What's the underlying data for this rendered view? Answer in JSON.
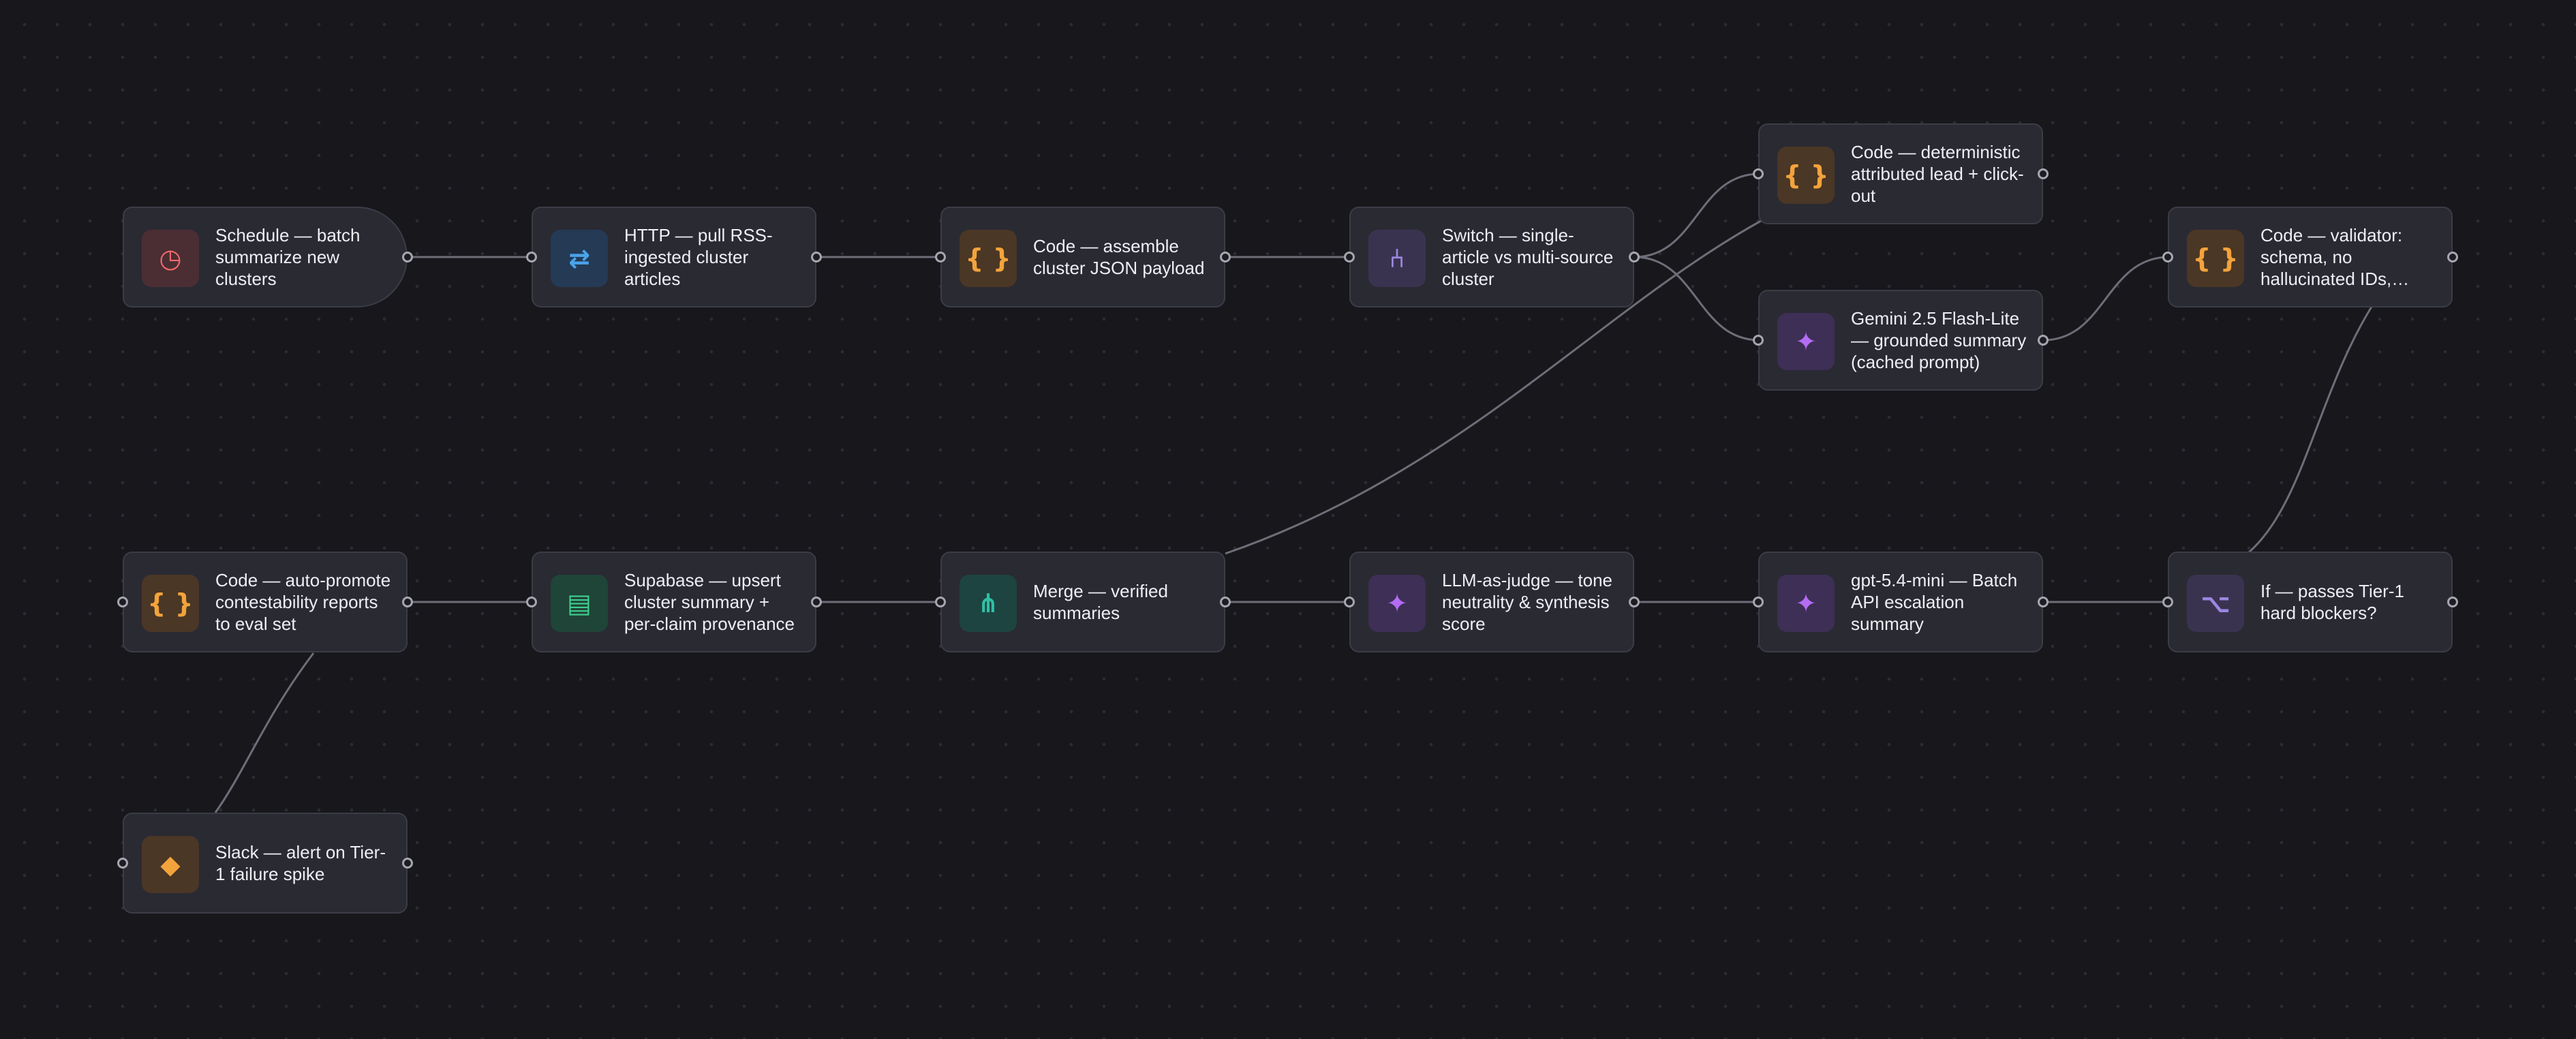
{
  "workflow": {
    "nodes": [
      {
        "id": "schedule",
        "label": "Schedule — batch summarize new clusters",
        "icon": "clock-icon",
        "glyph": "◷",
        "theme": "ic-schedule",
        "type": "trigger"
      },
      {
        "id": "http",
        "label": "HTTP — pull RSS-ingested cluster articles",
        "icon": "arrows-exchange-icon",
        "glyph": "⇄",
        "theme": "ic-http",
        "type": "action"
      },
      {
        "id": "code-assemble",
        "label": "Code — assemble cluster JSON payload",
        "icon": "code-braces-icon",
        "glyph": "{ }",
        "theme": "ic-code",
        "type": "action"
      },
      {
        "id": "switch",
        "label": "Switch — single-article vs multi-source cluster",
        "icon": "branch-fork-icon",
        "glyph": "⑃",
        "theme": "ic-switch",
        "type": "action"
      },
      {
        "id": "code-lead",
        "label": "Code — deterministic attributed lead + click-out",
        "icon": "code-braces-icon",
        "glyph": "{ }",
        "theme": "ic-code",
        "type": "action"
      },
      {
        "id": "gemini",
        "label": "Gemini 2.5 Flash-Lite — grounded summary (cached prompt)",
        "icon": "sparkle-icon",
        "glyph": "✦",
        "theme": "ic-gemini",
        "type": "action"
      },
      {
        "id": "validator",
        "label": "Code — validator: schema, no hallucinated IDs,…",
        "icon": "code-braces-icon",
        "glyph": "{ }",
        "theme": "ic-code",
        "type": "action"
      },
      {
        "id": "auto-promote",
        "label": "Code — auto-promote contestability reports to eval set",
        "icon": "code-braces-icon",
        "glyph": "{ }",
        "theme": "ic-code",
        "type": "action"
      },
      {
        "id": "supabase",
        "label": "Supabase — upsert cluster summary + per-claim provenance",
        "icon": "database-icon",
        "glyph": "▤",
        "theme": "ic-supabase",
        "type": "action"
      },
      {
        "id": "merge",
        "label": "Merge — verified summaries",
        "icon": "merge-icon",
        "glyph": "⋔",
        "theme": "ic-merge",
        "type": "action"
      },
      {
        "id": "judge",
        "label": "LLM-as-judge — tone neutrality & synthesis score",
        "icon": "sparkle-icon",
        "glyph": "✦",
        "theme": "ic-gemini",
        "type": "action"
      },
      {
        "id": "gpt",
        "label": "gpt-5.4-mini — Batch API escalation summary",
        "icon": "sparkle-icon",
        "glyph": "✦",
        "theme": "ic-gemini",
        "type": "action"
      },
      {
        "id": "if",
        "label": "If — passes Tier-1 hard blockers?",
        "icon": "option-branch-icon",
        "glyph": "⌥",
        "theme": "ic-if",
        "type": "action"
      },
      {
        "id": "slack",
        "label": "Slack — alert on Tier-1 failure spike",
        "icon": "diamond-icon",
        "glyph": "◆",
        "theme": "ic-slack",
        "type": "action"
      }
    ],
    "edge_color": "#6e6e78"
  }
}
